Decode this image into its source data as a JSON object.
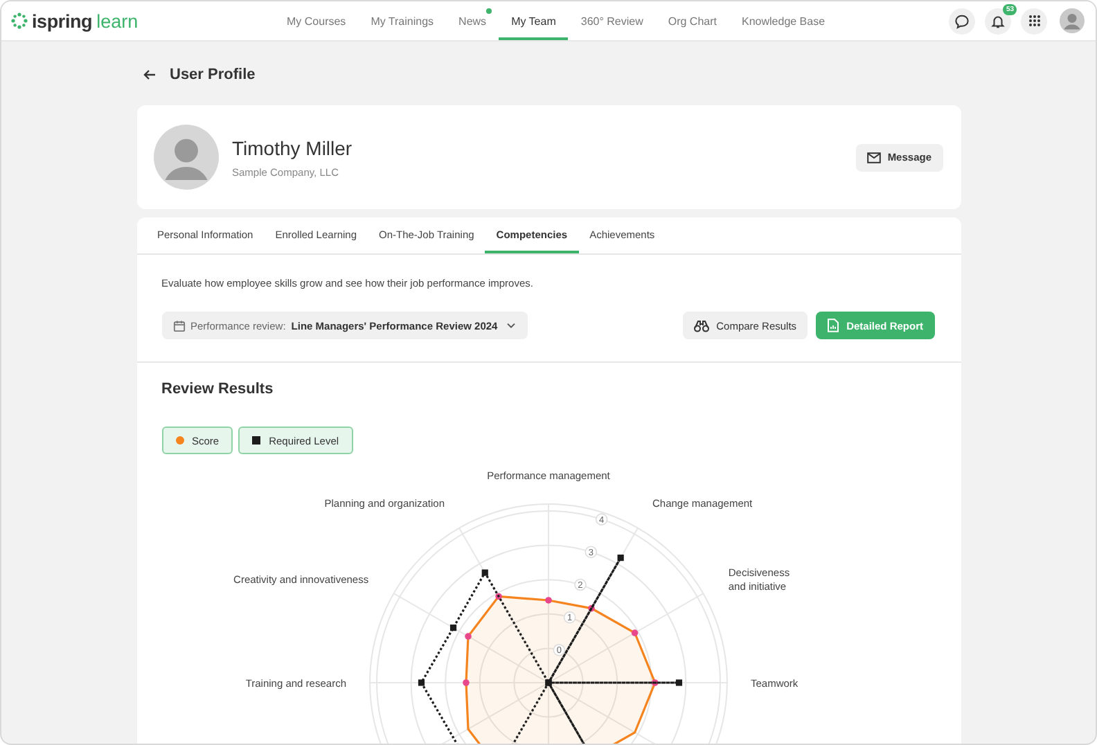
{
  "logo": {
    "name": "ispring",
    "product": "learn"
  },
  "nav": [
    {
      "label": "My Courses",
      "selected": false,
      "dot": false
    },
    {
      "label": "My Trainings",
      "selected": false,
      "dot": false
    },
    {
      "label": "News",
      "selected": false,
      "dot": true
    },
    {
      "label": "My Team",
      "selected": true,
      "dot": false
    },
    {
      "label": "360° Review",
      "selected": false,
      "dot": false
    },
    {
      "label": "Org Chart",
      "selected": false,
      "dot": false
    },
    {
      "label": "Knowledge Base",
      "selected": false,
      "dot": false
    }
  ],
  "notifications_badge": "53",
  "page_title": "User Profile",
  "profile": {
    "name": "Timothy Miller",
    "company": "Sample Company, LLC",
    "message_button": "Message"
  },
  "tabs": [
    {
      "label": "Personal Information",
      "selected": false
    },
    {
      "label": "Enrolled Learning",
      "selected": false
    },
    {
      "label": "On-The-Job Training",
      "selected": false
    },
    {
      "label": "Competencies",
      "selected": true
    },
    {
      "label": "Achievements",
      "selected": false
    }
  ],
  "description": "Evaluate how employee skills grow and see how their job performance improves.",
  "review_select": {
    "label": "Performance review:",
    "value": "Line Managers' Performance Review 2024"
  },
  "buttons": [
    {
      "label": "Compare Results",
      "kind": "secondary"
    },
    {
      "label": "Detailed Report",
      "kind": "primary"
    }
  ],
  "results": {
    "title": "Review Results",
    "legend": [
      {
        "label": "Score",
        "kind": "dot",
        "color": "#f5841f"
      },
      {
        "label": "Required Level",
        "kind": "square",
        "color": "#1c1c1c"
      }
    ],
    "radar": {
      "axes": [
        "Performance management",
        "Planning and organization",
        "Change management",
        "Creativity and innovativeness",
        "Decisiveness\nand initiative",
        "Training and research",
        "Teamwork"
      ],
      "scale_labels": [
        "0",
        "1",
        "2",
        "3",
        "4"
      ]
    }
  }
}
